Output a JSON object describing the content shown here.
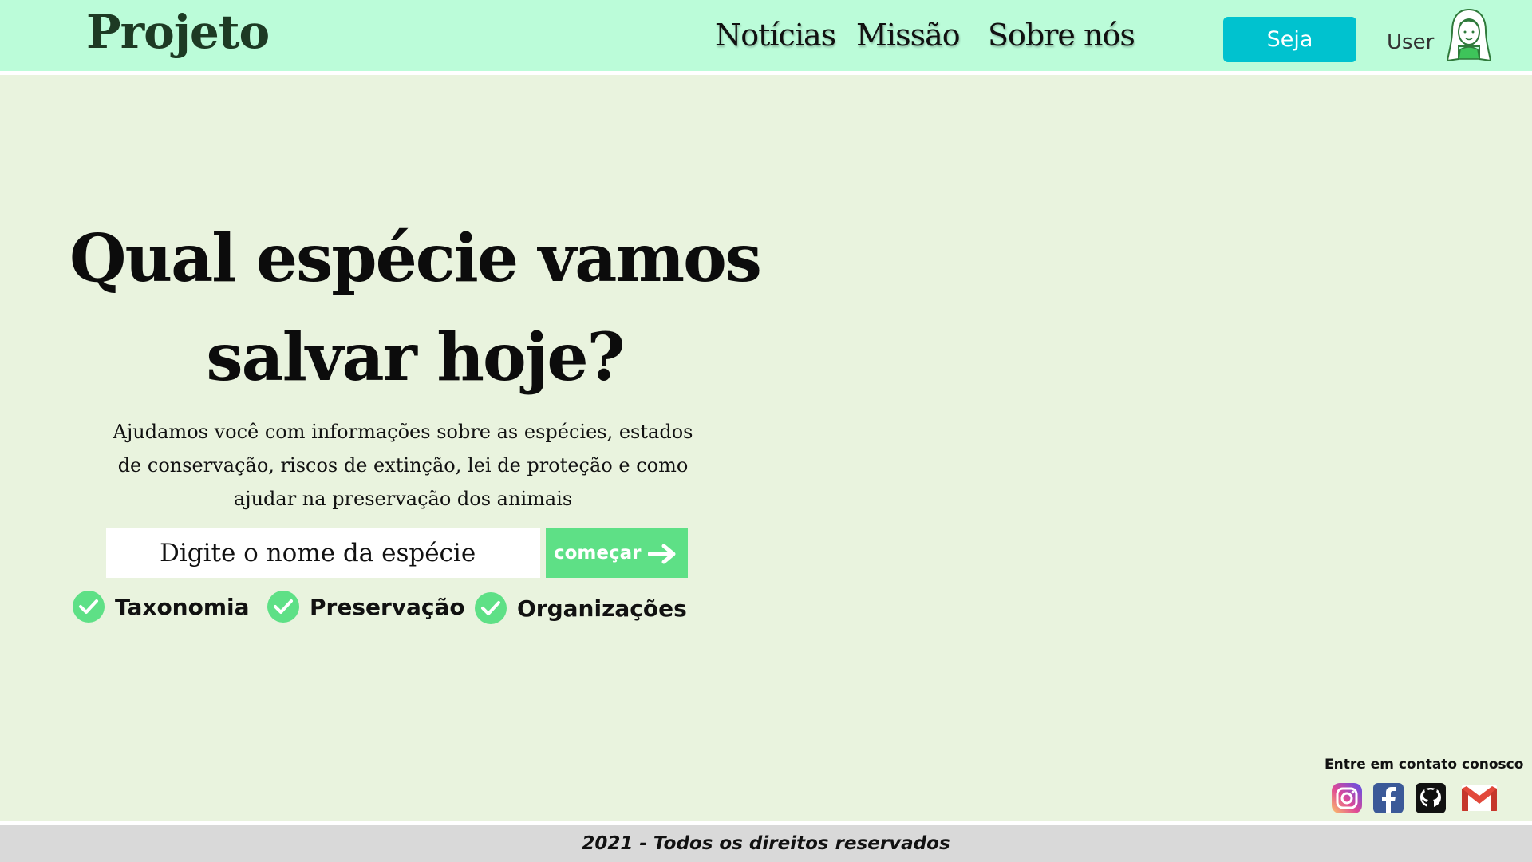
{
  "header": {
    "logo": "Projeto",
    "nav": [
      "Notícias",
      "Missão",
      "Sobre nós"
    ],
    "cta_label": "Seja",
    "user_label": "User"
  },
  "hero": {
    "title_line1": "Qual espécie vamos",
    "title_line2": "salvar hoje?",
    "description": "Ajudamos você com informações sobre as espécies, estados de conservação, riscos de extinção, lei de proteção e como ajudar na preservação dos animais"
  },
  "search": {
    "placeholder": "Digite o nome da espécie",
    "button_label": "começar"
  },
  "features": [
    "Taxonomia",
    "Preservação",
    "Organizações"
  ],
  "contact": {
    "label": "Entre em contato conosco",
    "icons": [
      "instagram-icon",
      "facebook-icon",
      "github-icon",
      "gmail-icon"
    ]
  },
  "footer": {
    "text": "2021 - Todos os direitos reservados"
  },
  "colors": {
    "header_bg": "#bbfcd9",
    "page_bg": "#e9f3de",
    "cta_bg": "#00c2cf",
    "accent_green": "#5ee086",
    "footer_bg": "#d9d9d9"
  }
}
